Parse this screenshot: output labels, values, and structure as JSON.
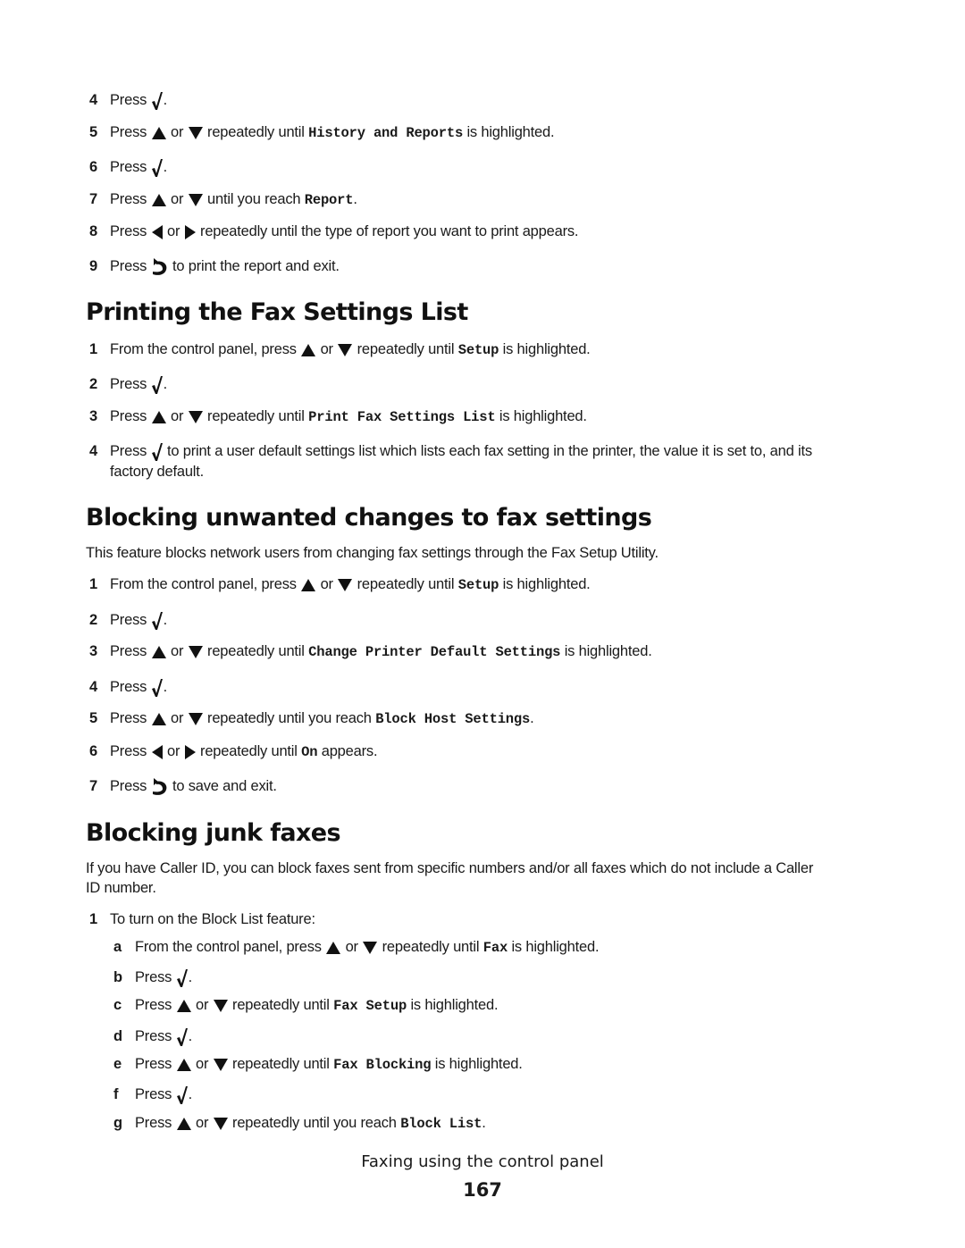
{
  "top_steps": [
    {
      "num": "4",
      "parts": [
        "Press",
        "check",
        "."
      ]
    },
    {
      "num": "5",
      "parts": [
        "Press",
        "up",
        "or",
        "down",
        "repeatedly until",
        {
          "mono": "History and Reports"
        },
        "is highlighted."
      ]
    },
    {
      "num": "6",
      "parts": [
        "Press",
        "check",
        "."
      ]
    },
    {
      "num": "7",
      "parts": [
        "Press",
        "up",
        "or",
        "down",
        "until you reach",
        {
          "mono": "Report"
        },
        "."
      ]
    },
    {
      "num": "8",
      "parts": [
        "Press",
        "left",
        "or",
        "right",
        "repeatedly until the type of report you want to print appears."
      ]
    },
    {
      "num": "9",
      "parts": [
        "Press",
        "back",
        "to print the report and exit."
      ]
    }
  ],
  "sections": {
    "fax_settings_list": {
      "heading": "Printing the Fax Settings List",
      "steps": [
        {
          "num": "1",
          "parts": [
            "From the control panel, press",
            "up",
            "or",
            "down",
            "repeatedly until",
            {
              "mono": "Setup"
            },
            "is highlighted."
          ]
        },
        {
          "num": "2",
          "parts": [
            "Press",
            "check",
            "."
          ]
        },
        {
          "num": "3",
          "parts": [
            "Press",
            "up",
            "or",
            "down",
            "repeatedly until",
            {
              "mono": "Print Fax Settings List"
            },
            "is highlighted."
          ]
        },
        {
          "num": "4",
          "parts": [
            "Press",
            "check",
            "to print a user default settings list which lists each fax setting in the printer, the value it is set to, and its"
          ],
          "continuation": "factory default."
        }
      ]
    },
    "blocking_changes": {
      "heading": "Blocking unwanted changes to fax settings",
      "intro": "This feature blocks network users from changing fax settings through the Fax Setup Utility.",
      "steps": [
        {
          "num": "1",
          "parts": [
            "From the control panel, press",
            "up",
            "or",
            "down",
            "repeatedly until",
            {
              "mono": "Setup"
            },
            "is highlighted."
          ]
        },
        {
          "num": "2",
          "parts": [
            "Press",
            "check",
            "."
          ]
        },
        {
          "num": "3",
          "parts": [
            "Press",
            "up",
            "or",
            "down",
            "repeatedly until",
            {
              "mono": "Change Printer Default Settings"
            },
            "is highlighted."
          ]
        },
        {
          "num": "4",
          "parts": [
            "Press",
            "check",
            "."
          ]
        },
        {
          "num": "5",
          "parts": [
            "Press",
            "up",
            "or",
            "down",
            "repeatedly until you reach",
            {
              "mono": "Block Host Settings"
            },
            "."
          ]
        },
        {
          "num": "6",
          "parts": [
            "Press",
            "left",
            "or",
            "right",
            "repeatedly until",
            {
              "mono": "On"
            },
            "appears."
          ]
        },
        {
          "num": "7",
          "parts": [
            "Press",
            "back",
            "to save and exit."
          ]
        }
      ]
    },
    "junk_faxes": {
      "heading": "Blocking junk faxes",
      "intro_line1": "If you have Caller ID, you can block faxes sent from specific numbers and/or all faxes which do not include a Caller",
      "intro_line2": "ID number.",
      "steps": [
        {
          "num": "1",
          "parts": [
            "To turn on the Block List feature:"
          ]
        }
      ],
      "substeps": [
        {
          "num": "a",
          "parts": [
            "From the control panel, press",
            "up",
            "or",
            "down",
            "repeatedly until",
            {
              "mono": "Fax"
            },
            "is highlighted."
          ]
        },
        {
          "num": "b",
          "parts": [
            "Press",
            "check",
            "."
          ]
        },
        {
          "num": "c",
          "parts": [
            "Press",
            "up",
            "or",
            "down",
            "repeatedly until",
            {
              "mono": "Fax Setup"
            },
            "is highlighted."
          ]
        },
        {
          "num": "d",
          "parts": [
            "Press",
            "check",
            "."
          ]
        },
        {
          "num": "e",
          "parts": [
            "Press",
            "up",
            "or",
            "down",
            "repeatedly until",
            {
              "mono": "Fax Blocking"
            },
            "is highlighted."
          ]
        },
        {
          "num": "f",
          "parts": [
            "Press",
            "check",
            "."
          ]
        },
        {
          "num": "g",
          "parts": [
            "Press",
            "up",
            "or",
            "down",
            "repeatedly until you reach",
            {
              "mono": "Block List"
            },
            "."
          ]
        }
      ]
    }
  },
  "icons": {
    "check": "checkmark-icon",
    "up": "up-arrow-icon",
    "down": "down-arrow-icon",
    "left": "left-arrow-icon",
    "right": "right-arrow-icon",
    "back": "back-icon"
  },
  "footer": {
    "title": "Faxing using the control panel",
    "page_number": "167"
  }
}
